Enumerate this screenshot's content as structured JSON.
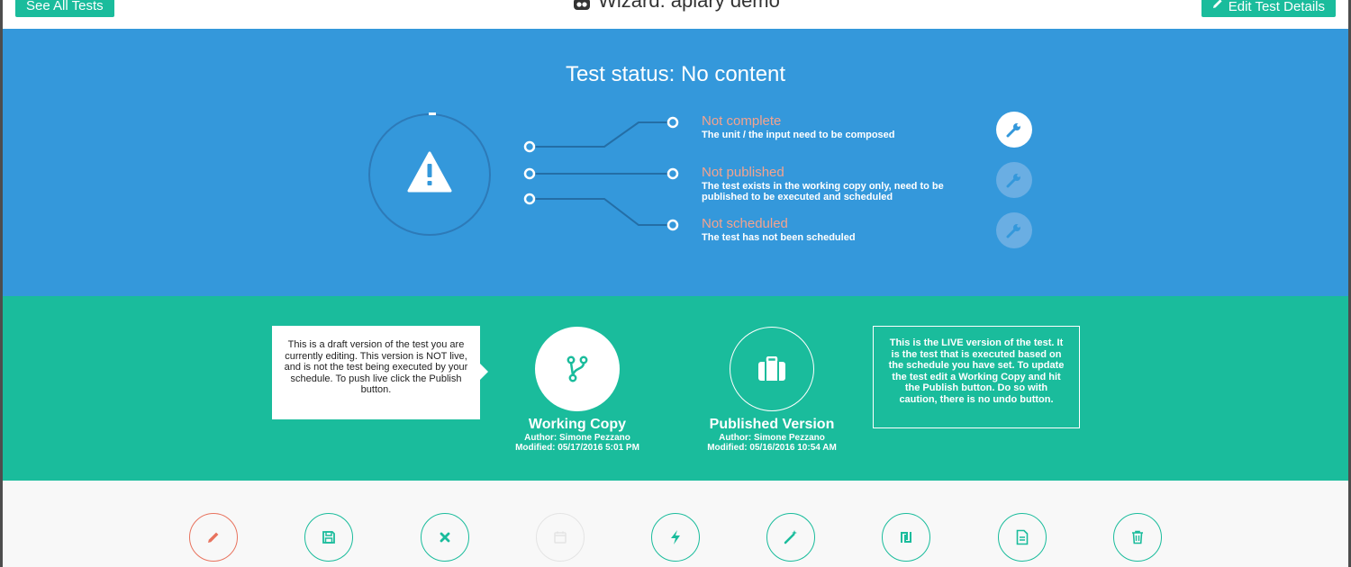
{
  "header": {
    "see_all_label": "See All Tests",
    "title": "Wizard: apiary demo",
    "edit_label": "Edit Test Details"
  },
  "status": {
    "title": "Test status: No content",
    "items": [
      {
        "label": "Not complete",
        "desc": "The unit / the input need to be composed",
        "action_enabled": true
      },
      {
        "label": "Not published",
        "desc": "The test exists in the working copy only, need to be published to be executed and scheduled",
        "action_enabled": false
      },
      {
        "label": "Not scheduled",
        "desc": "The test has not been scheduled",
        "action_enabled": false
      }
    ]
  },
  "versions": {
    "draft_tip": "This is a draft version of the test you are currently editing. This version is NOT live, and is not the test being executed by your schedule. To push live click the Publish button.",
    "live_tip": "This is the LIVE version of the test. It is the test that is executed based on the schedule you have set. To update the test edit a Working Copy and hit the Publish button. Do so with caution, there is no undo button.",
    "working": {
      "name": "Working Copy",
      "author": "Author: Simone Pezzano",
      "modified": "Modified: 05/17/2016 5:01 PM"
    },
    "published": {
      "name": "Published Version",
      "author": "Author: Simone Pezzano",
      "modified": "Modified: 05/16/2016 10:54 AM"
    }
  },
  "actions": [
    {
      "icon": "pencil-icon",
      "state": "danger"
    },
    {
      "icon": "save-icon",
      "state": "enabled"
    },
    {
      "icon": "close-icon",
      "state": "enabled"
    },
    {
      "icon": "calendar-icon",
      "state": "disabled"
    },
    {
      "icon": "bolt-icon",
      "state": "enabled"
    },
    {
      "icon": "magic-wand-icon",
      "state": "enabled"
    },
    {
      "icon": "shekel-icon",
      "state": "enabled"
    },
    {
      "icon": "document-icon",
      "state": "enabled"
    },
    {
      "icon": "trash-icon",
      "state": "enabled"
    }
  ],
  "colors": {
    "accent_green": "#1abc9c",
    "status_blue": "#3498db",
    "warning_salmon": "#f4a38e",
    "danger_red": "#e8735e"
  }
}
